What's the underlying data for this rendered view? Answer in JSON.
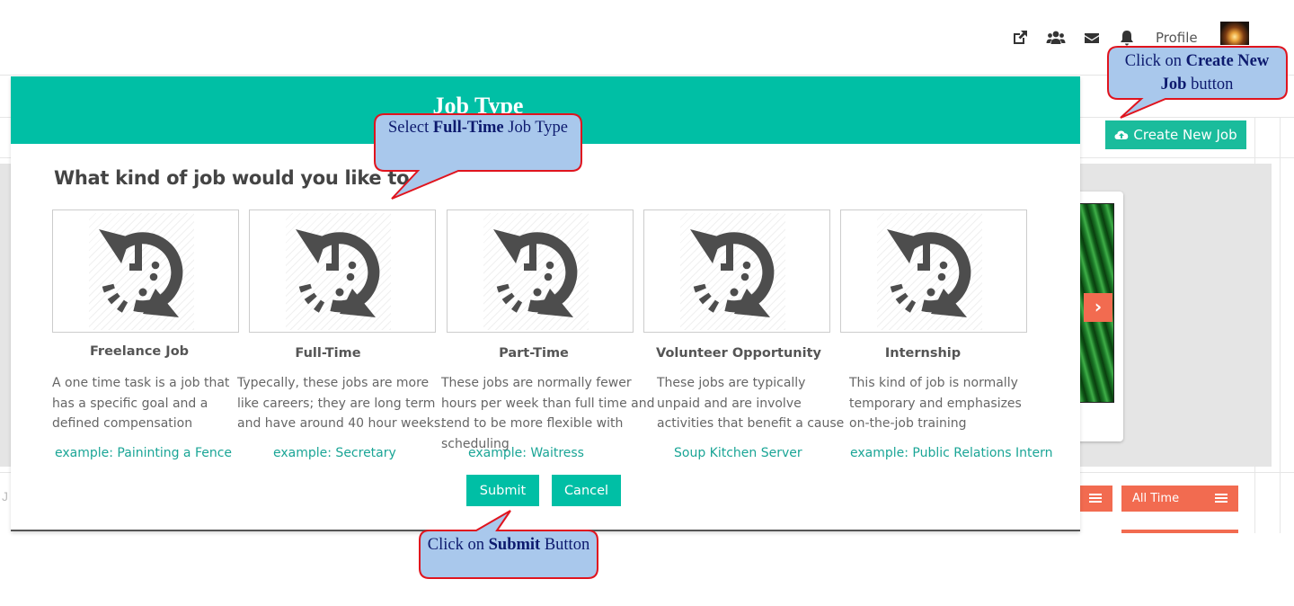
{
  "topbar": {
    "icons": [
      "external-link-icon",
      "users-icon",
      "envelope-icon",
      "bell-icon"
    ],
    "profile_label": "Profile"
  },
  "background": {
    "create_job_label": "Create New Job",
    "filter_right_label": "All Time",
    "left_cut_text": "J"
  },
  "modal": {
    "title": "Job Type",
    "question": "What kind of job would you like to",
    "job_types": [
      {
        "name": "Freelance Job",
        "description": "A one time task is a job that has a specific goal and a defined compensation",
        "example": "example: Paininting a Fence"
      },
      {
        "name": "Full-Time",
        "description": "Typecally, these jobs are more like careers; they are long term and have around 40 hour weeks.",
        "example": "example: Secretary"
      },
      {
        "name": "Part-Time",
        "description": "These jobs are normally fewer hours per week than full time and tend to be more flexible with scheduling",
        "example": "example: Waitress"
      },
      {
        "name": "Volunteer Opportunity",
        "description": "These jobs are typically unpaid and are involve activities that benefit a cause",
        "example": "Soup Kitchen Server"
      },
      {
        "name": "Internship",
        "description": "This kind of job is normally temporary and emphasizes on-the-job training",
        "example": "example: Public Relations Intern"
      }
    ],
    "submit_label": "Submit",
    "cancel_label": "Cancel"
  },
  "callouts": {
    "create_job": {
      "pre": "Click on ",
      "bold": "Create New Job",
      "post": " button"
    },
    "full_time": {
      "pre": "Select ",
      "bold": "Full-Time",
      "post": " Job Type"
    },
    "submit": {
      "pre": "Click on ",
      "bold": "Submit",
      "post": " Button"
    }
  },
  "colors": {
    "accent_teal": "#00bfa5",
    "accent_orange": "#f26b50",
    "callout_fill": "#a9c8ec",
    "callout_border": "#e0141e",
    "callout_text": "#0d1a6e"
  }
}
